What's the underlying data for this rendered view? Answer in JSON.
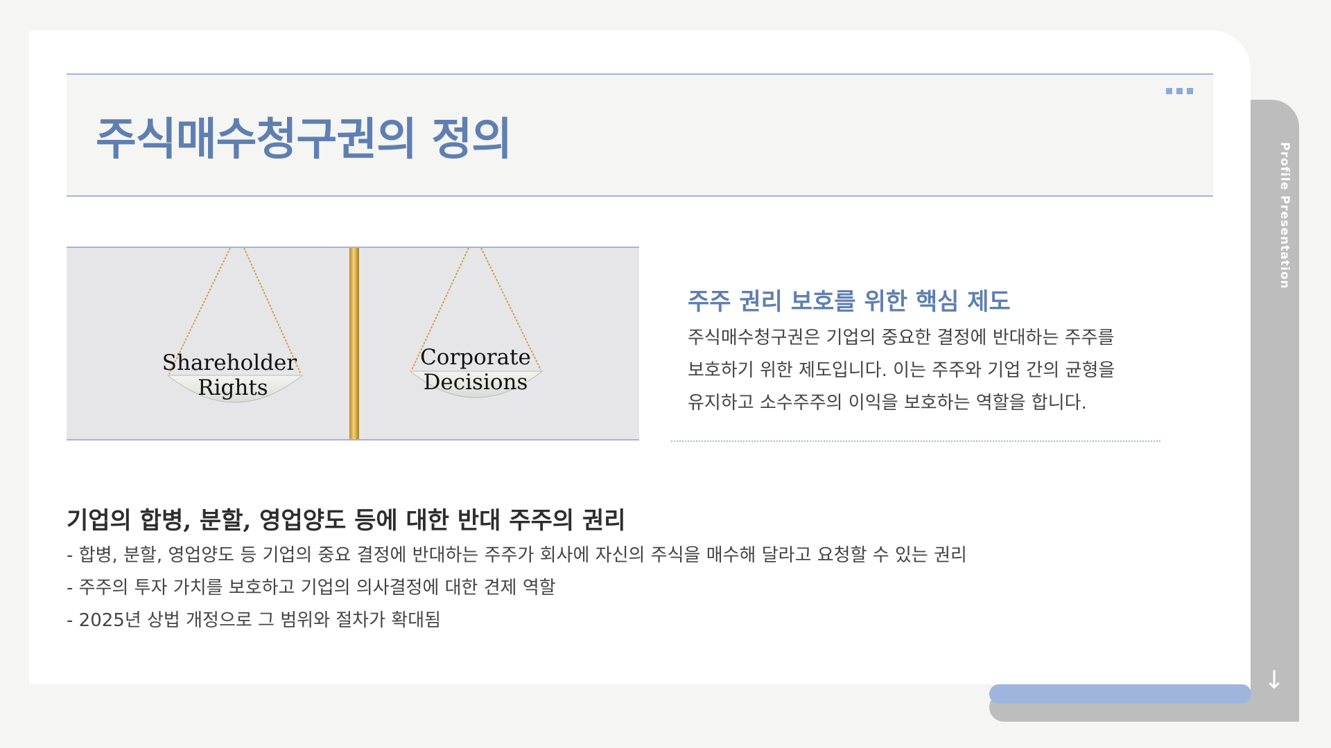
{
  "side_tab": {
    "label": "Profile Presentation",
    "arrow_icon": "arrow-down-icon"
  },
  "header": {
    "title": "주식매수청구권의 정의",
    "menu_icon": "dots-icon"
  },
  "image": {
    "left_plate": [
      "Shareholder",
      "Rights"
    ],
    "right_plate": [
      "Corporate",
      "Decisions"
    ]
  },
  "intro": {
    "heading": "주주 권리 보호를 위한 핵심 제도",
    "lines": [
      "주식매수청구권은 기업의 중요한 결정에 반대하는 주주를",
      "보호하기 위한 제도입니다. 이는 주주와 기업 간의 균형을",
      "유지하고 소수주주의 이익을 보호하는 역할을 합니다."
    ]
  },
  "detail": {
    "heading": "기업의 합병, 분할, 영업양도 등에 대한 반대 주주의 권리",
    "bullets": [
      "- 합병, 분할, 영업양도 등 기업의 중요 결정에 반대하는 주주가 회사에 자신의 주식을 매수해 달라고 요청할 수 있는 권리",
      "- 주주의 투자 가치를 보호하고 기업의 의사결정에 대한 견제 역할",
      "- 2025년 상법 개정으로 그 범위와 절차가 확대됨"
    ]
  },
  "colors": {
    "accent": "#5f7fb1",
    "accent_light": "#9fb5de",
    "tab_gray": "#bdbdbd"
  }
}
